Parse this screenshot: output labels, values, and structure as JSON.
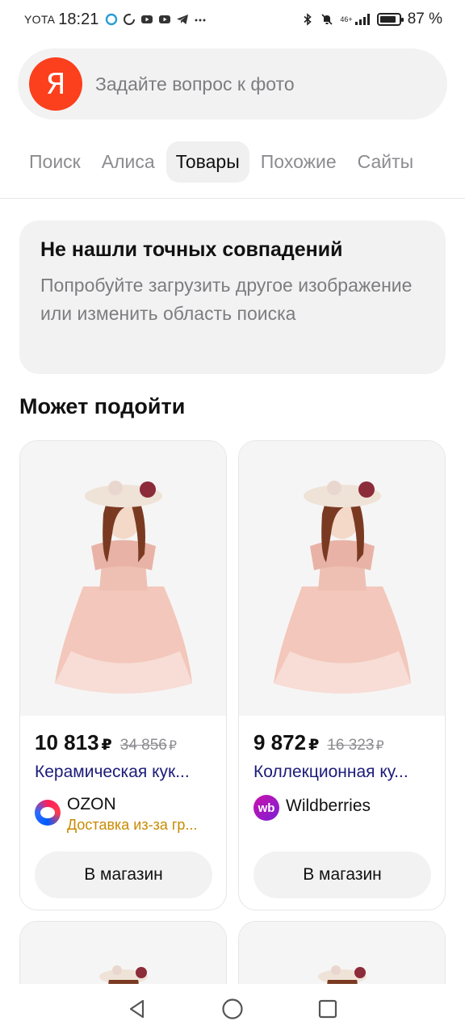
{
  "status_bar": {
    "carrier": "YOTA",
    "time": "18:21",
    "network": "46+",
    "battery": "87 %",
    "battery_level": 0.87
  },
  "search": {
    "logo_letter": "Я",
    "placeholder": "Задайте вопрос к фото"
  },
  "tabs": [
    {
      "label": "Поиск",
      "active": false
    },
    {
      "label": "Алиса",
      "active": false
    },
    {
      "label": "Товары",
      "active": true
    },
    {
      "label": "Похожие",
      "active": false
    },
    {
      "label": "Сайты",
      "active": false
    }
  ],
  "notice": {
    "title": "Не нашли точных совпадений",
    "text": "Попробуйте загрузить другое изображение или изменить область поиска"
  },
  "section_title": "Может подойти",
  "products": [
    {
      "price": "10 813",
      "currency": "₽",
      "old_price": "34 856",
      "old_currency": "₽",
      "title": "Керамическая кук...",
      "shop_name": "OZON",
      "shop_logo_icon": "ozon-logo-icon",
      "delivery": "Доставка из-за гр...",
      "button": "В магазин"
    },
    {
      "price": "9 872",
      "currency": "₽",
      "old_price": "16 323",
      "old_currency": "₽",
      "title": "Коллекционная ку...",
      "shop_name": "Wildberries",
      "shop_logo_icon": "wildberries-logo-icon",
      "shop_logo_text": "wb",
      "button": "В магазин"
    }
  ],
  "colors": {
    "yandex_red": "#fc3f1d",
    "link_blue": "#1b1b7a",
    "delivery_orange": "#c88a00",
    "wildberries_purple": "#cb11ab"
  },
  "navigation": {
    "icons": [
      "back-triangle-icon",
      "home-circle-icon",
      "recents-square-icon"
    ]
  }
}
